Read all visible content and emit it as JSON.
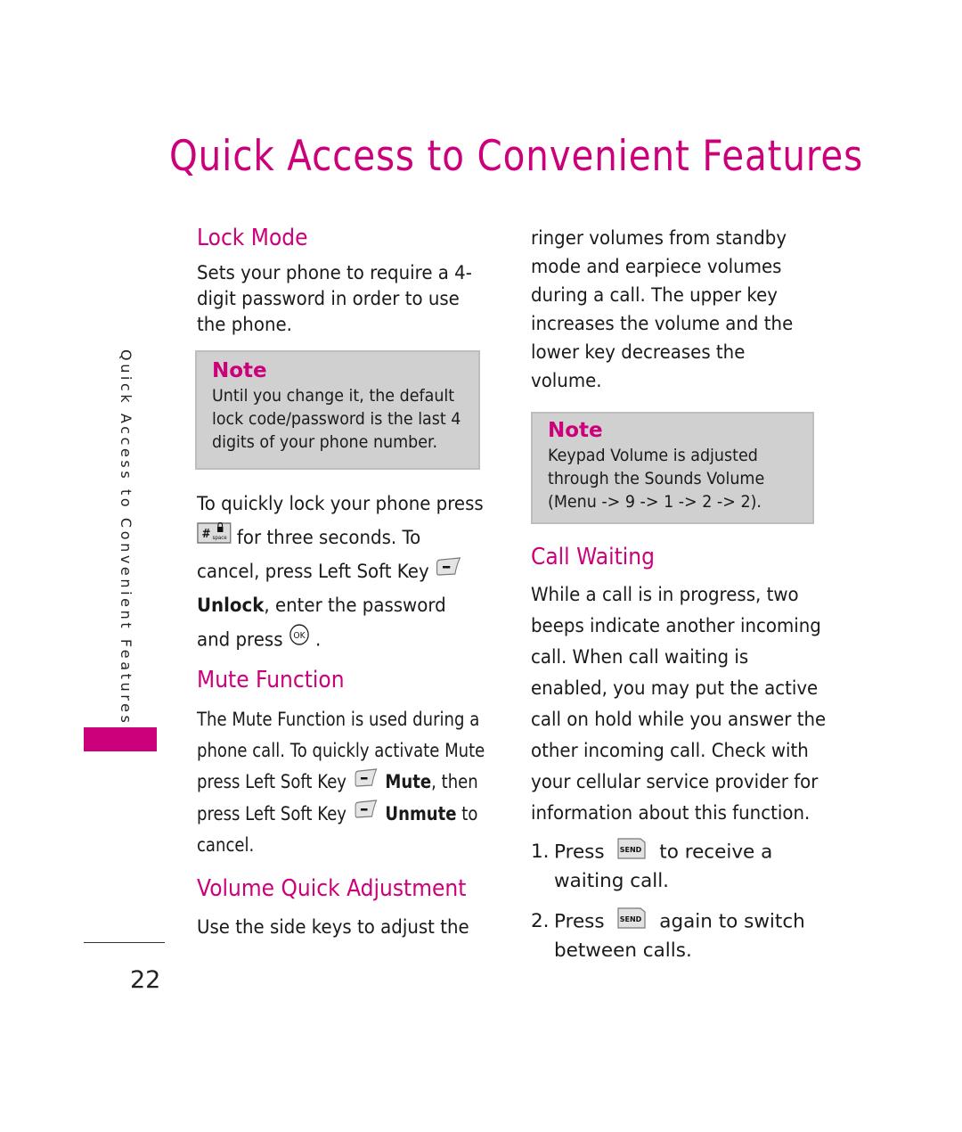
{
  "page": {
    "title": "Quick Access to Convenient Features",
    "side_tab_label": "Quick Access to Convenient Features",
    "page_number": "22",
    "accent_color": "#cc007a",
    "note_bg_color": "#d0d0d0"
  },
  "lock_mode": {
    "heading": "Lock Mode",
    "description": "Sets your phone to require a 4-digit password in order to use the phone.",
    "note": {
      "title": "Note",
      "text": "Until you change it, the default lock code/password is the last 4 digits of your phone number."
    },
    "instructions": {
      "part1": "To quickly lock your phone press",
      "key1_icon": "hash-space-lock-key-icon",
      "part2": "for three seconds. To cancel, press Left Soft Key",
      "key2_icon": "left-soft-key-icon",
      "bold_word": "Unlock",
      "part3": ", enter the password and press",
      "key3_icon": "ok-key-icon",
      "key3_label": "OK",
      "part4": "."
    }
  },
  "mute_function": {
    "heading": "Mute Function",
    "part1": "The Mute Function is used during a phone call. To quickly activate Mute press Left Soft Key",
    "bold1": "Mute",
    "part2": ", then press Left Soft Key",
    "bold2": "Unmute",
    "part3": "to cancel."
  },
  "volume_quick_adjustment": {
    "heading": "Volume Quick Adjustment",
    "text_left": "Use the side keys to adjust the",
    "text_right": "ringer volumes from standby mode and earpiece volumes during a call. The upper key increases the volume and the lower key decreases the volume.",
    "note": {
      "title": "Note",
      "text": "Keypad Volume is adjusted through the Sounds Volume (Menu -> 9 -> 1 -> 2 -> 2)."
    }
  },
  "call_waiting": {
    "heading": "Call Waiting",
    "description": "While a call is in progress, two beeps indicate another incoming call. When call waiting is enabled, you may put the active call on hold while you answer the other incoming call. Check with your cellular service provider for information about this function.",
    "steps": [
      {
        "num": "1.",
        "before": "Press",
        "key_label": "SEND",
        "after": "to receive a waiting call."
      },
      {
        "num": "2.",
        "before": "Press",
        "key_label": "SEND",
        "after": "again to switch between calls."
      }
    ]
  }
}
